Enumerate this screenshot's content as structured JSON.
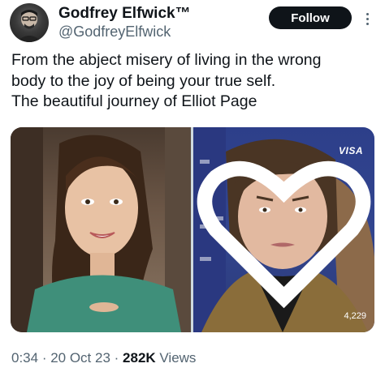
{
  "author": {
    "display_name": "Godfrey Elfwick™",
    "handle": "@GodfreyElfwick"
  },
  "follow_label": "Follow",
  "tweet": {
    "lines": [
      "From the abject misery of living in the wrong",
      "body to the joy of being your true self.",
      "The beautiful journey of Elliot Page"
    ]
  },
  "media": {
    "right_photo": {
      "brand": "VISA",
      "like_count": "4,229"
    }
  },
  "meta": {
    "time": "0:34",
    "separator": " · ",
    "date": "20 Oct 23",
    "views_count": "282K",
    "views_label": " Views"
  }
}
